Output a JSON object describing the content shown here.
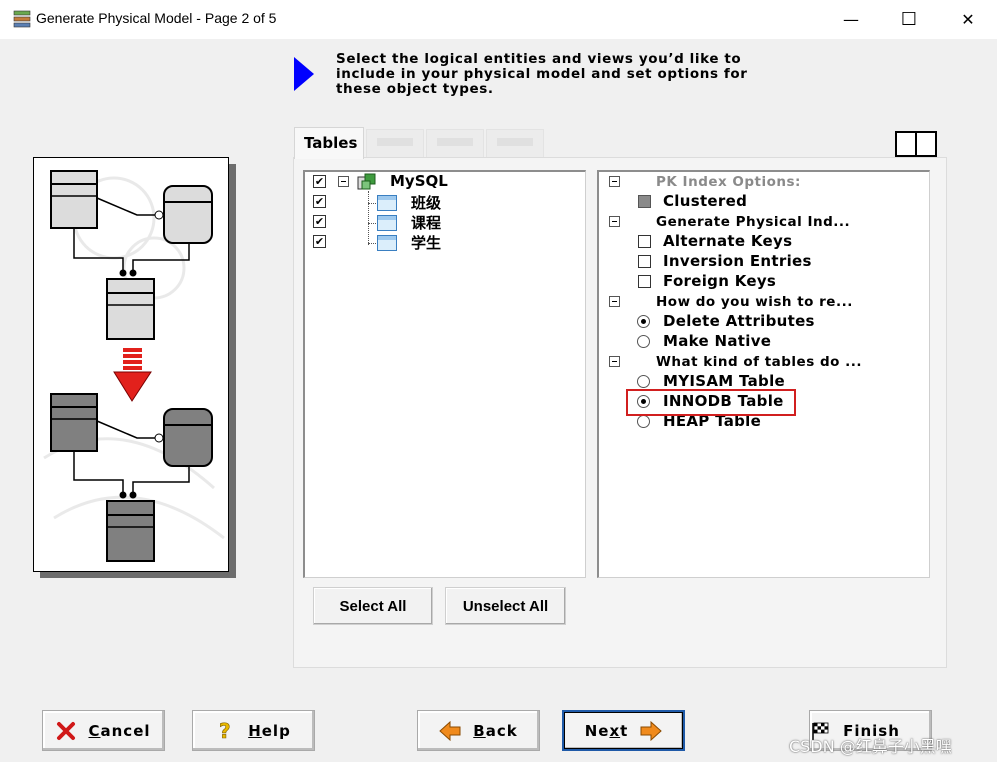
{
  "window": {
    "title": "Generate Physical Model - Page 2 of 5",
    "minimize": "—",
    "maximize": "☐",
    "close": "✕"
  },
  "instruction": "Select the logical entities and views you’d like to\ninclude in your physical model and set options for\nthese object types.",
  "tabs": {
    "active": "Tables"
  },
  "tree": {
    "root": {
      "label": "MySQL",
      "checked": true
    },
    "children": [
      {
        "label": "班级",
        "checked": true
      },
      {
        "label": "课程",
        "checked": true
      },
      {
        "label": "学生",
        "checked": true
      }
    ],
    "check_mark": "✔"
  },
  "options": {
    "pk_header": "PK Index Options:",
    "clustered": "Clustered",
    "gen_header": "Generate Physical Ind...",
    "alternate_keys": "Alternate Keys",
    "inversion_entries": "Inversion Entries",
    "foreign_keys": "Foreign Keys",
    "wish_header": "How do you wish to re...",
    "delete_attributes": "Delete Attributes",
    "make_native": "Make Native",
    "kind_header": "What kind of tables do ...",
    "myisam": "MYISAM Table",
    "innodb": "INNODB Table",
    "heap": "HEAP Table"
  },
  "buttons": {
    "select_all": "Select All",
    "unselect_all": "Unselect All",
    "cancel_first": "C",
    "cancel_rest": "ancel",
    "help_first": "H",
    "help_rest": "elp",
    "back_first": "B",
    "back_rest": "ack",
    "next_a": "Ne",
    "next_u": "x",
    "next_b": "t",
    "finish": "Finish"
  },
  "watermark": "CSDN @红鼻子小黑嘿",
  "colors": {
    "accent": "#0000ff",
    "highlight": "#d11f1f",
    "arrow": "#e2211c"
  }
}
